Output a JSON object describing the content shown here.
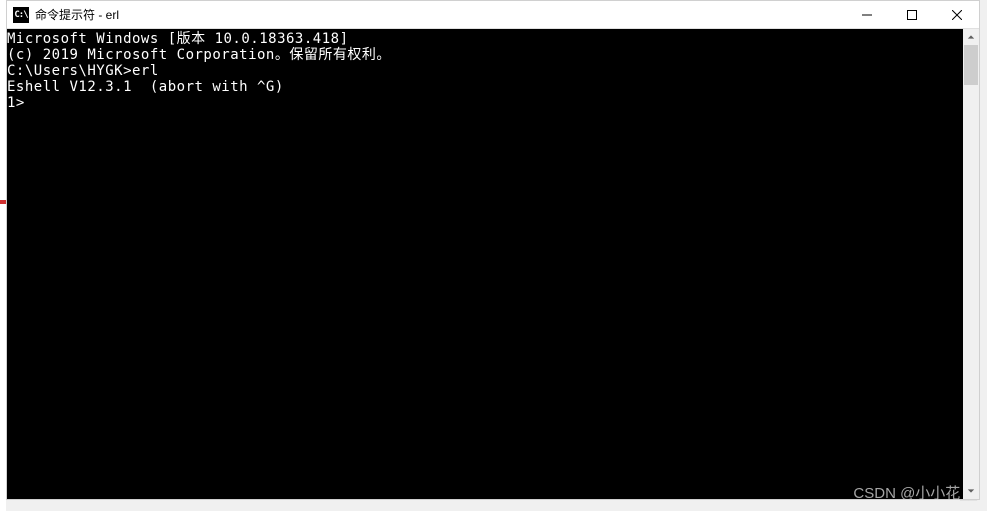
{
  "window": {
    "icon_text": "C:\\",
    "title": "命令提示符 - erl"
  },
  "terminal": {
    "line1": "Microsoft Windows [版本 10.0.18363.418]",
    "line2": "(c) 2019 Microsoft Corporation。保留所有权利。",
    "blank1": "",
    "line3": "C:\\Users\\HYGK>erl",
    "line4": "Eshell V12.3.1  (abort with ^G)",
    "prompt": "1> "
  },
  "watermark": "CSDN @小小花__"
}
